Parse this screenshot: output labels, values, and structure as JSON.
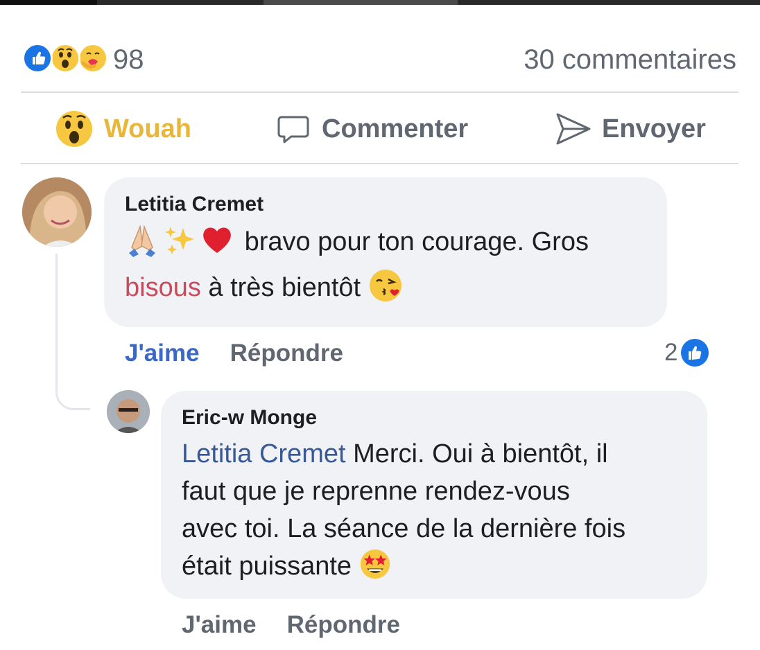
{
  "reactions": {
    "icons": [
      "like-icon",
      "wow-emoji-icon",
      "care-emoji-icon"
    ],
    "count": "98",
    "comments_label": "30 commentaires"
  },
  "actions": [
    {
      "label": "Wouah",
      "icon": "wow-emoji-icon",
      "color": "#e8b73a"
    },
    {
      "label": "Commenter",
      "icon": "comment-icon"
    },
    {
      "label": "Envoyer",
      "icon": "send-icon"
    }
  ],
  "comments": [
    {
      "author": "Letitia Cremet",
      "avatar": "avatar-woman",
      "emojis": [
        "praying-hands-icon",
        "sparkles-icon",
        "red-heart-icon"
      ],
      "text_line1": "bravo pour ton courage. Gros",
      "highlight": "bisous",
      "text_line2": "à très bientôt",
      "trailing_emoji": "kissing-heart-icon",
      "like_label": "J'aime",
      "reply_label": "Répondre",
      "reaction_count": "2"
    },
    {
      "author": "Eric-w Monge",
      "avatar": "avatar-man",
      "mention": "Letitia Cremet",
      "text_line1": "Merci. Oui à bientôt, il",
      "text_line2": "faut que je reprenne rendez-vous",
      "text_line3": "avec toi. La séance de la dernière fois",
      "text_line4": "était puissante",
      "trailing_emoji": "star-struck-icon",
      "like_label": "J'aime",
      "reply_label": "Répondre"
    }
  ],
  "colors": {
    "accent": "#1b74e4",
    "wow_yellow": "#e8b73a",
    "mention": "#385898",
    "bubble": "#f0f2f5"
  }
}
